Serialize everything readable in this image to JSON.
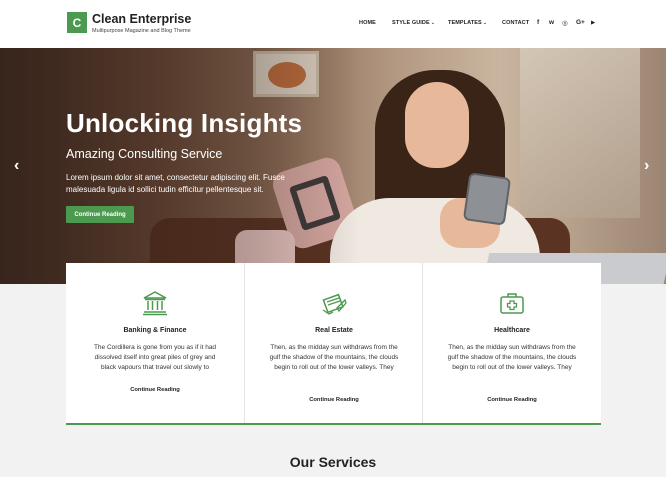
{
  "brand": {
    "logo_letter": "C",
    "title": "Clean Enterprise",
    "tagline": "Multipurpose Magazine and Blog Theme",
    "accent_color": "#4c9a4f"
  },
  "nav": {
    "items": [
      {
        "label": "HOME",
        "has_dropdown": false
      },
      {
        "label": "STYLE GUIDE",
        "has_dropdown": true
      },
      {
        "label": "TEMPLATES",
        "has_dropdown": true
      },
      {
        "label": "CONTACT",
        "has_dropdown": false
      }
    ],
    "dropdown_glyph": "⌄",
    "social": [
      {
        "icon": "facebook-icon",
        "glyph": "f"
      },
      {
        "icon": "twitter-icon",
        "glyph": "w"
      },
      {
        "icon": "instagram-icon",
        "glyph": "◎"
      },
      {
        "icon": "google-plus-icon",
        "glyph": "G+"
      },
      {
        "icon": "youtube-icon",
        "glyph": "▶"
      }
    ]
  },
  "hero": {
    "title": "Unlocking Insights",
    "subtitle": "Amazing Consulting Service",
    "text": "Lorem ipsum dolor sit amet, consectetur adipiscing elit. Fusce malesuada ligula id sollici tudin efficitur pellentesque sit.",
    "button_label": "Continue Reading",
    "prev_arrow": "‹",
    "next_arrow": "›"
  },
  "features": [
    {
      "icon": "bank-icon",
      "title": "Banking & Finance",
      "text": "The Cordillera is gone from you as if it had dissolved itself into great piles of grey and black vapours that travel out slowly to",
      "link": "Continue Reading"
    },
    {
      "icon": "real-estate-icon",
      "title": "Real Estate",
      "text": "Then, as the midday sun withdraws from the gulf the shadow of the mountains, the clouds begin to roll out of the lower valleys. They",
      "link": "Continue Reading"
    },
    {
      "icon": "medical-kit-icon",
      "title": "Healthcare",
      "text": "Then, as the midday sun withdraws from the gulf the shadow of the mountains, the clouds begin to roll out of the lower valleys. They",
      "link": "Continue Reading"
    }
  ],
  "services": {
    "title": "Our Services"
  }
}
